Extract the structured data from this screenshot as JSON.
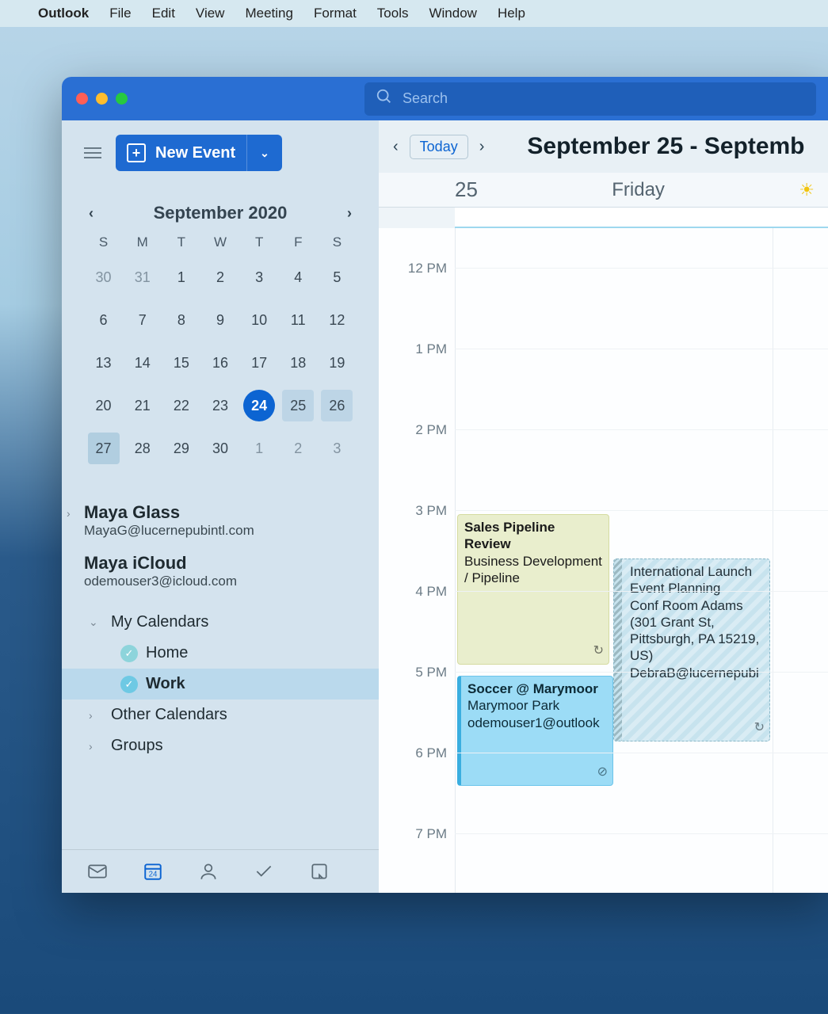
{
  "menubar": {
    "app": "Outlook",
    "items": [
      "File",
      "Edit",
      "View",
      "Meeting",
      "Format",
      "Tools",
      "Window",
      "Help"
    ]
  },
  "search": {
    "placeholder": "Search"
  },
  "toolbar": {
    "new_event": "New Event",
    "today": "Today"
  },
  "date_range_title": "September 25 - Septemb",
  "mini_cal": {
    "title": "September 2020",
    "dow": [
      "S",
      "M",
      "T",
      "W",
      "T",
      "F",
      "S"
    ],
    "rows": [
      [
        "30",
        "31",
        "1",
        "2",
        "3",
        "4",
        "5"
      ],
      [
        "6",
        "7",
        "8",
        "9",
        "10",
        "11",
        "12"
      ],
      [
        "13",
        "14",
        "15",
        "16",
        "17",
        "18",
        "19"
      ],
      [
        "20",
        "21",
        "22",
        "23",
        "24",
        "25",
        "26"
      ],
      [
        "27",
        "28",
        "29",
        "30",
        "1",
        "2",
        "3"
      ]
    ],
    "today": "24",
    "range": [
      "25",
      "26"
    ],
    "next_start": "27",
    "leading_gray": [
      "30",
      "31"
    ],
    "trailing_gray": [
      "1",
      "2",
      "3"
    ]
  },
  "accounts": [
    {
      "name": "Maya Glass",
      "email": "MayaG@lucernepubintl.com"
    },
    {
      "name": "Maya iCloud",
      "email": "odemouser3@icloud.com"
    }
  ],
  "sections": {
    "my_calendars": "My Calendars",
    "home": "Home",
    "work": "Work",
    "other_calendars": "Other Calendars",
    "groups": "Groups"
  },
  "day_header": {
    "num": "25",
    "name": "Friday"
  },
  "hours": [
    "12 PM",
    "1 PM",
    "2 PM",
    "3 PM",
    "4 PM",
    "5 PM",
    "6 PM",
    "7 PM"
  ],
  "events": {
    "ev1": {
      "title": "Sales Pipeline Review",
      "line2": "Business Development / Pipeline"
    },
    "ev2": {
      "title": "International Launch Event Planning",
      "loc": "Conf Room Adams (301 Grant St, Pittsburgh, PA 15219, US)",
      "org": "DebraB@lucernepubi"
    },
    "ev3": {
      "title": "Soccer @ Marymoor",
      "loc": "Marymoor Park",
      "org": "odemouser1@outlook"
    }
  }
}
